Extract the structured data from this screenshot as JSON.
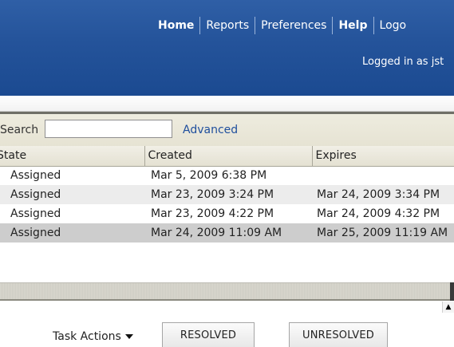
{
  "topnav": {
    "items": [
      {
        "label": "Home",
        "bold": true
      },
      {
        "label": "Reports",
        "bold": false
      },
      {
        "label": "Preferences",
        "bold": false
      },
      {
        "label": "Help",
        "bold": true
      },
      {
        "label": "Logo",
        "bold": false
      }
    ],
    "logged_in": "Logged in as jst"
  },
  "search": {
    "label": "Search",
    "value": "",
    "advanced_label": "Advanced"
  },
  "table": {
    "columns": [
      "State",
      "Created",
      "Expires"
    ],
    "rows": [
      {
        "state": "Assigned",
        "created": "Mar 5, 2009 6:38 PM",
        "expires": "",
        "style": "white"
      },
      {
        "state": "Assigned",
        "created": "Mar 23, 2009 3:24 PM",
        "expires": "Mar 24, 2009 3:34 PM",
        "style": "alt"
      },
      {
        "state": "Assigned",
        "created": "Mar 23, 2009 4:22 PM",
        "expires": "Mar 24, 2009 4:32 PM",
        "style": "white"
      },
      {
        "state": "Assigned",
        "created": "Mar 24, 2009 11:09 AM",
        "expires": "Mar 25, 2009 11:19 AM",
        "style": "selected"
      }
    ]
  },
  "actions": {
    "task_actions_label": "Task Actions",
    "resolved_label": "RESOLVED",
    "unresolved_label": "UNRESOLVED"
  },
  "colors": {
    "header_blue": "#24539a",
    "link_blue": "#1f4f9d",
    "selected_row": "#cdcdcd"
  }
}
